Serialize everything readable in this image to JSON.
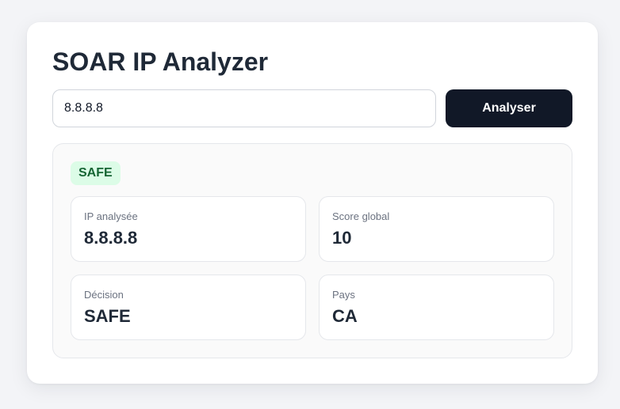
{
  "app": {
    "title": "SOAR IP Analyzer"
  },
  "search": {
    "value": "8.8.8.8",
    "button_label": "Analyser"
  },
  "result": {
    "badge": "SAFE",
    "badge_color": "#dcfce7",
    "badge_text_color": "#166534",
    "stats": [
      {
        "label": "IP analysée",
        "value": "8.8.8.8"
      },
      {
        "label": "Score global",
        "value": "10"
      },
      {
        "label": "Décision",
        "value": "SAFE"
      },
      {
        "label": "Pays",
        "value": "CA"
      }
    ]
  },
  "colors": {
    "button_bg": "#111827",
    "page_bg": "#f3f4f7"
  }
}
